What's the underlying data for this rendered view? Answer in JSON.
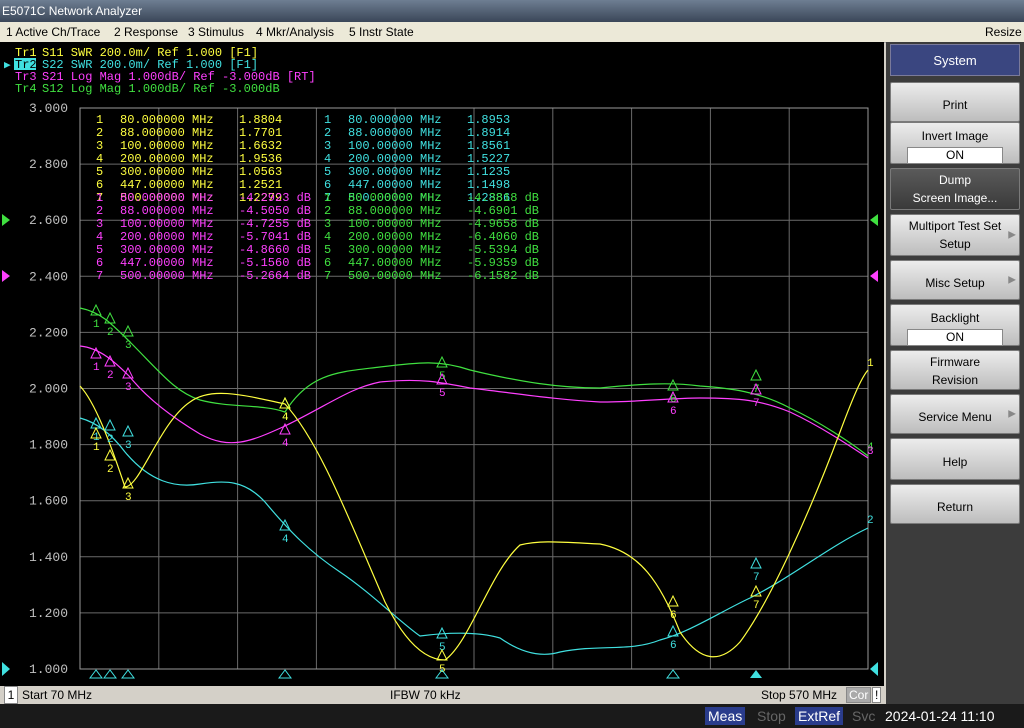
{
  "window": {
    "title": "E5071C Network Analyzer",
    "resize": "Resize"
  },
  "menu": [
    "1 Active Ch/Trace",
    "2 Response",
    "3 Stimulus",
    "4 Mkr/Analysis",
    "5 Instr State"
  ],
  "traces": [
    {
      "label": "Tr1",
      "text": "S11  SWR 200.0m/ Ref 1.000 [F1]",
      "color": "#ffff40"
    },
    {
      "label": "Tr2",
      "text": "S22  SWR 200.0m/ Ref 1.000 [F1]",
      "color": "#40e0e0",
      "active": true
    },
    {
      "label": "Tr3",
      "text": "S21  Log Mag 1.000dB/ Ref -3.000dB [RT]",
      "color": "#ff40ff"
    },
    {
      "label": "Tr4",
      "text": "S12  Log Mag 1.000dB/ Ref -3.000dB",
      "color": "#40e040"
    }
  ],
  "y_ticks": [
    "3.000",
    "2.800",
    "2.600",
    "2.400",
    "2.200",
    "2.000",
    "1.800",
    "1.600",
    "1.400",
    "1.200",
    "1.000"
  ],
  "markers": {
    "tr1": [
      {
        "n": "1",
        "f": "80.000000 MHz",
        "v": "1.8804"
      },
      {
        "n": "2",
        "f": "88.000000 MHz",
        "v": "1.7701"
      },
      {
        "n": "3",
        "f": "100.00000 MHz",
        "v": "1.6632"
      },
      {
        "n": "4",
        "f": "200.00000 MHz",
        "v": "1.9536"
      },
      {
        "n": "5",
        "f": "300.00000 MHz",
        "v": "1.0563"
      },
      {
        "n": "6",
        "f": "447.00000 MHz",
        "v": "1.2521"
      },
      {
        "n": "7",
        "f": "500.00000 MHz",
        "v": "1.2279"
      }
    ],
    "tr2": [
      {
        "n": "1",
        "f": "80.000000 MHz",
        "v": "1.8953"
      },
      {
        "n": "2",
        "f": "88.000000 MHz",
        "v": "1.8914"
      },
      {
        "n": "3",
        "f": "100.00000 MHz",
        "v": "1.8561"
      },
      {
        "n": "4",
        "f": "200.00000 MHz",
        "v": "1.5227"
      },
      {
        "n": "5",
        "f": "300.00000 MHz",
        "v": "1.1235"
      },
      {
        "n": "6",
        "f": "447.00000 MHz",
        "v": "1.1498"
      },
      {
        "n": "7",
        "f": "500.00000 MHz",
        "v": "1.2886"
      }
    ],
    "tr3": [
      {
        "n": "1",
        "f": "80.000000 MHz",
        "v": "-4.2923 dB"
      },
      {
        "n": "2",
        "f": "88.000000 MHz",
        "v": "-4.5050 dB"
      },
      {
        "n": "3",
        "f": "100.00000 MHz",
        "v": "-4.7255 dB"
      },
      {
        "n": "4",
        "f": "200.00000 MHz",
        "v": "-5.7041 dB"
      },
      {
        "n": "5",
        "f": "300.00000 MHz",
        "v": "-4.8660 dB"
      },
      {
        "n": "6",
        "f": "447.00000 MHz",
        "v": "-5.1560 dB"
      },
      {
        "n": "7",
        "f": "500.00000 MHz",
        "v": "-5.2664 dB"
      }
    ],
    "tr4": [
      {
        "n": "1",
        "f": "80.000000 MHz",
        "v": "-4.3818 dB"
      },
      {
        "n": "2",
        "f": "88.000000 MHz",
        "v": "-4.6901 dB"
      },
      {
        "n": "3",
        "f": "100.00000 MHz",
        "v": "-4.9658 dB"
      },
      {
        "n": "4",
        "f": "200.00000 MHz",
        "v": "-6.4060 dB"
      },
      {
        "n": "5",
        "f": "300.00000 MHz",
        "v": "-5.5394 dB"
      },
      {
        "n": "6",
        "f": "447.00000 MHz",
        "v": "-5.9359 dB"
      },
      {
        "n": "7",
        "f": "500.00000 MHz",
        "v": "-6.1582 dB"
      }
    ]
  },
  "softkeys": {
    "title": "System",
    "items": [
      {
        "label": "Print"
      },
      {
        "label": "Invert Image",
        "value": "ON"
      },
      {
        "label": "Dump\nScreen Image...",
        "dark": true
      },
      {
        "label": "Multiport Test Set\nSetup",
        "arrow": true
      },
      {
        "label": "Misc Setup",
        "arrow": true
      },
      {
        "label": "Backlight",
        "value": "ON"
      },
      {
        "label": "Firmware\nRevision"
      },
      {
        "label": "Service Menu",
        "arrow": true
      },
      {
        "label": "Help"
      },
      {
        "label": "Return"
      }
    ]
  },
  "status": {
    "ch": "1",
    "start": "Start 70 MHz",
    "ifbw": "IFBW 70 kHz",
    "stop": "Stop 570 MHz",
    "cor": "Cor",
    "excl": "!"
  },
  "bottom": {
    "meas": "Meas",
    "stop": "Stop",
    "extref": "ExtRef",
    "svc": "Svc",
    "datetime": "2024-01-24 11:10"
  },
  "colors": {
    "tr1": "#ffff40",
    "tr2": "#40e0e0",
    "tr3": "#ff40ff",
    "tr4": "#40e040"
  }
}
